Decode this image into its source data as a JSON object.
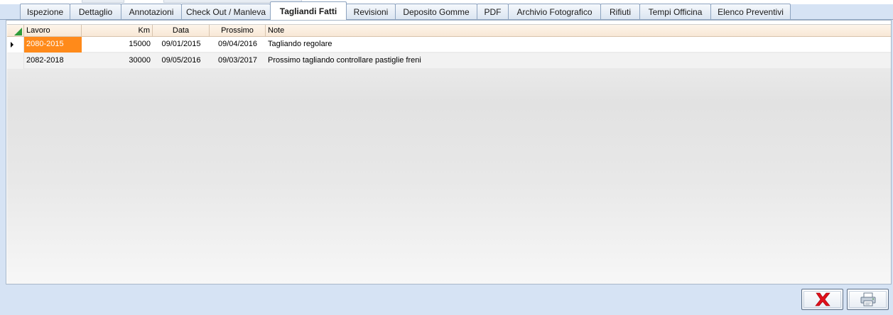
{
  "tabs": [
    {
      "label": "Ispezione"
    },
    {
      "label": "Dettaglio"
    },
    {
      "label": "Annotazioni"
    },
    {
      "label": "Check Out / Manleva"
    },
    {
      "label": "Tagliandi Fatti"
    },
    {
      "label": "Revisioni"
    },
    {
      "label": "Deposito Gomme"
    },
    {
      "label": "PDF"
    },
    {
      "label": "Archivio Fotografico"
    },
    {
      "label": "Rifiuti"
    },
    {
      "label": "Tempi Officina"
    },
    {
      "label": "Elenco Preventivi"
    }
  ],
  "active_tab": "Tagliandi Fatti",
  "grid": {
    "columns": {
      "lavoro": "Lavoro",
      "km": "Km",
      "data": "Data",
      "prossimo": "Prossimo",
      "note": "Note"
    },
    "rows": [
      {
        "lavoro": "2080-2015",
        "km": "15000",
        "data": "09/01/2015",
        "prossimo": "09/04/2016",
        "note": "Tagliando regolare"
      },
      {
        "lavoro": "2082-2018",
        "km": "30000",
        "data": "09/05/2016",
        "prossimo": "09/03/2017",
        "note": "Prossimo tagliando controllare pastiglie freni"
      }
    ]
  },
  "colors": {
    "selected_cell": "#ff8a1a",
    "close_icon": "#e0101a",
    "header_bg": "#fdf4ea"
  },
  "icons": {
    "close_button": "close-x-icon",
    "print_button": "printer-icon"
  }
}
